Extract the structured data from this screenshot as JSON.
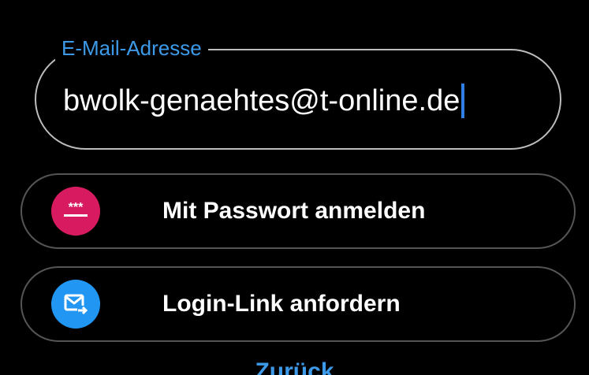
{
  "email": {
    "label": "E-Mail-Adresse",
    "value": "bwolk-genaehtes@t-online.de"
  },
  "options": [
    {
      "label": "Mit Passwort anmelden",
      "icon": "password-icon",
      "icon_color": "#d81b60"
    },
    {
      "label": "Login-Link anfordern",
      "icon": "mail-send-icon",
      "icon_color": "#2196f3"
    }
  ],
  "back_link": "Zurück",
  "colors": {
    "accent": "#3d9ae8",
    "background": "#000000",
    "field_border": "#bdbdbd",
    "button_border": "#555555"
  }
}
